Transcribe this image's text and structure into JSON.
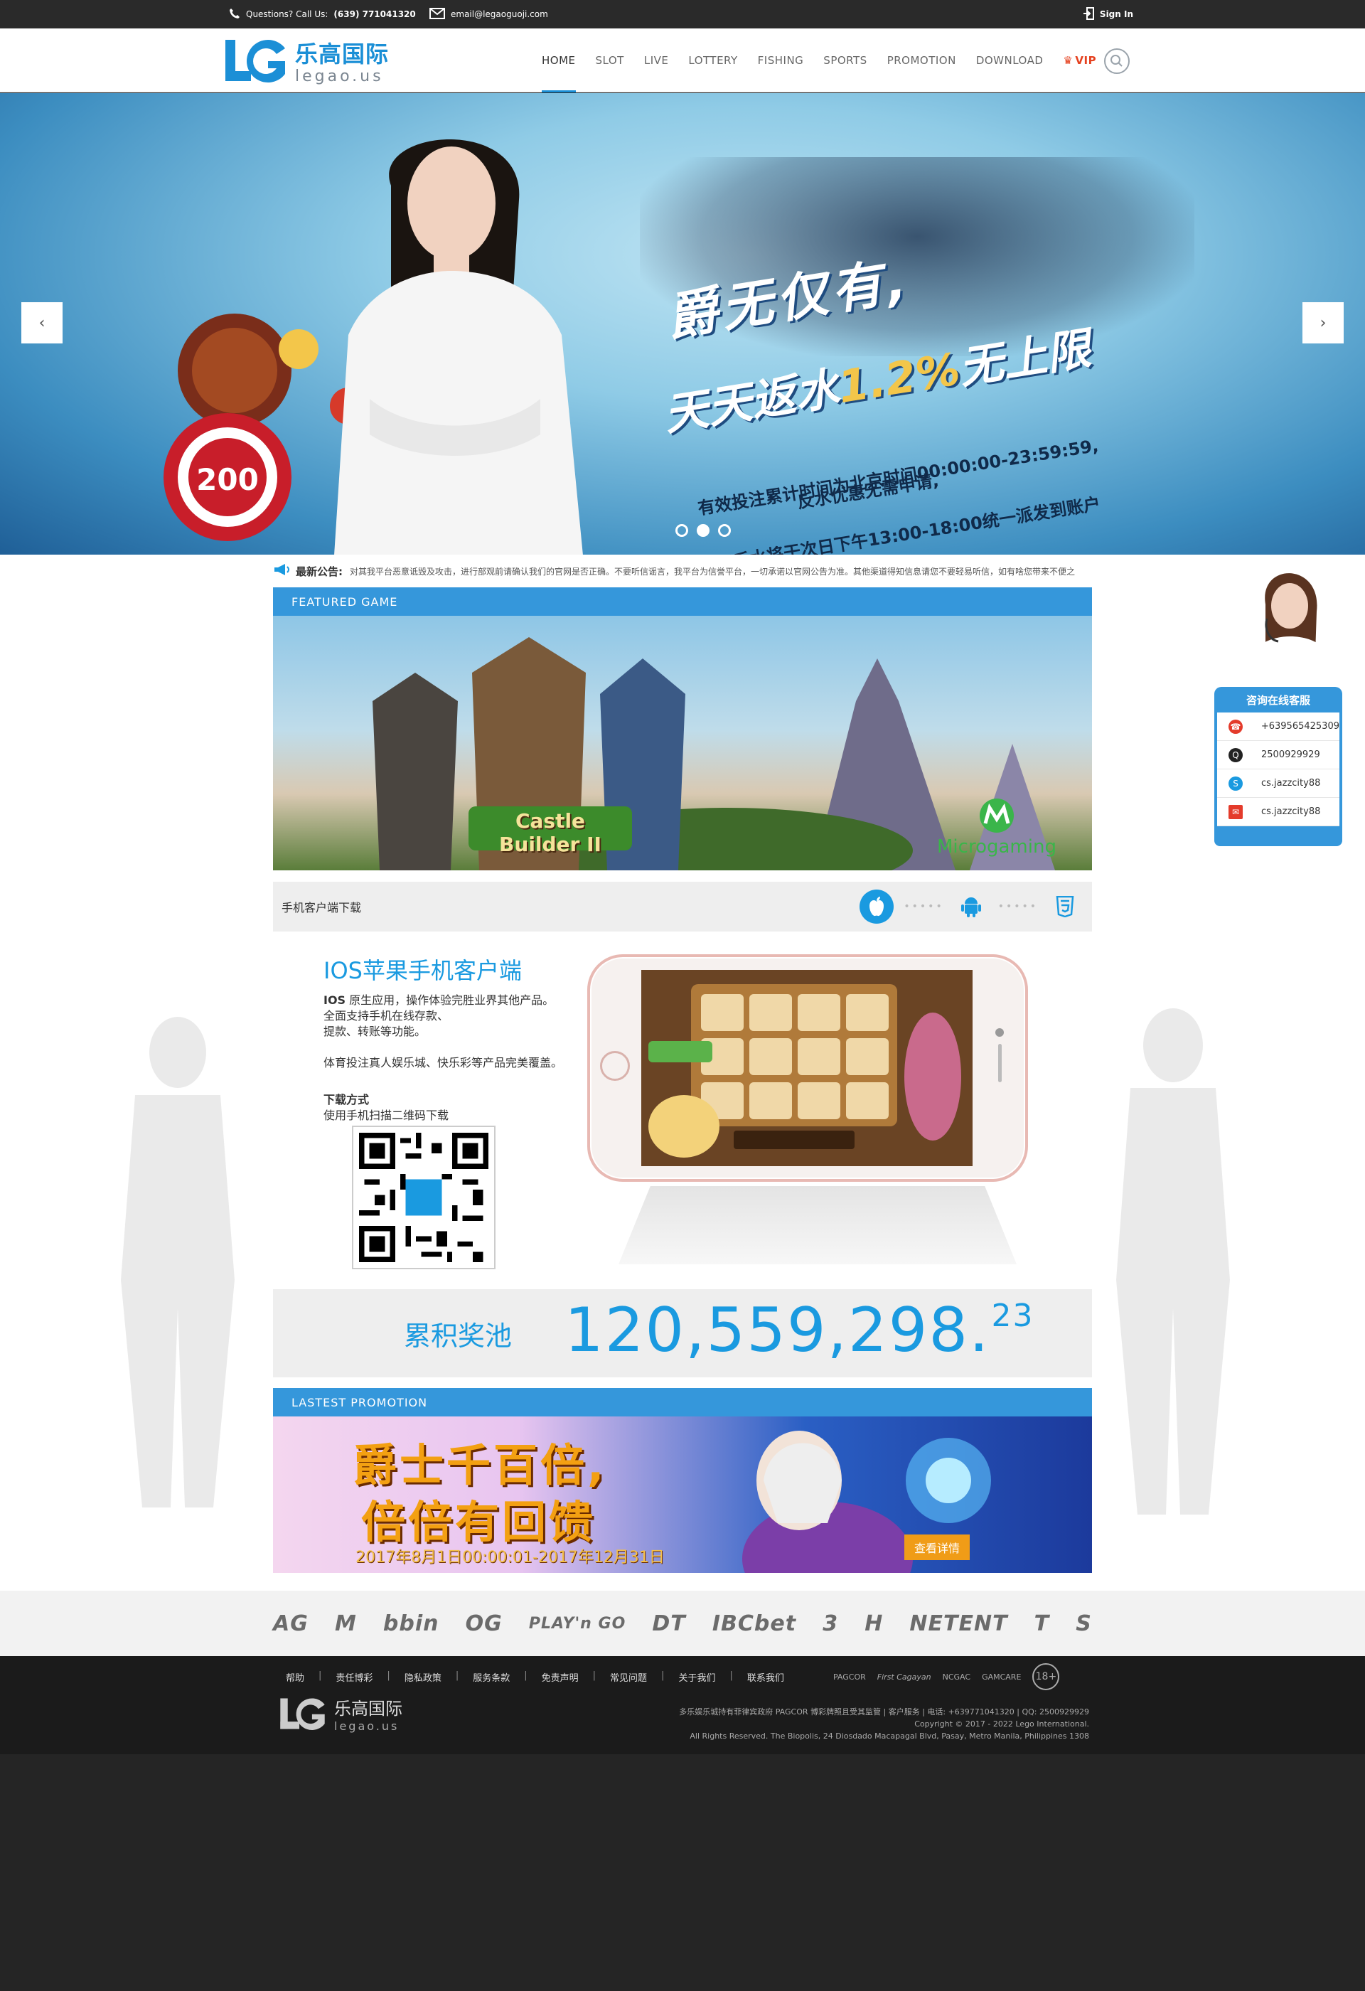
{
  "topbar": {
    "phone_label": "Questions? Call Us:",
    "phone_number": "(639) 771041320",
    "email": "email@legaoguoji.com",
    "signin": "Sign In"
  },
  "brand": {
    "name_cn": "乐高国际",
    "name_en": "legao.us"
  },
  "nav": [
    "HOME",
    "SLOT",
    "LIVE",
    "LOTTERY",
    "FISHING",
    "SPORTS",
    "PROMOTION",
    "DOWNLOAD",
    "VIP"
  ],
  "hero": {
    "headline": "爵无仅有,",
    "subline_a": "天天返水",
    "subline_b": "1.2%",
    "subline_c": "无上限",
    "desc_lines": [
      "有效投注累计时间为北京时间00:00:00-23:59:59,",
      "反水优惠无需申请,",
      "当天反水将于次日下午13:00-18:00统一派发到账户"
    ],
    "slides": 3,
    "active_slide": 2,
    "chip_value": "200"
  },
  "notice": {
    "label": "最新公告:",
    "message": "对其我平台恶意诋毁及攻击，进行部观前请确认我们的官网是否正确。不要听信谣言，我平台为信誉平台，一切承诺以官网公告为准。其他渠道得知信息请您不要轻易听信，如有啥您带来不便之"
  },
  "featured": {
    "title": "FEATURED GAME",
    "game_name": "Castle Builder II",
    "provider": "Microgaming"
  },
  "download": {
    "title": "手机客户端下载",
    "platforms": [
      "ios",
      "android",
      "html5"
    ],
    "active": "ios"
  },
  "ios": {
    "heading": "IOS苹果手机客户端",
    "lead": "IOS",
    "lines": [
      "原生应用，操作体验完胜业界其他产品。",
      "全面支持手机在线存款、",
      "提款、转账等功能。"
    ],
    "line2": "体育投注真人娱乐城、快乐彩等产品完美覆盖。",
    "dl_title": "下载方式",
    "dl_desc": "使用手机扫描二维码下载"
  },
  "jackpot": {
    "label": "累积奖池",
    "amount": "120,559,298.",
    "cents": "23"
  },
  "promo": {
    "title": "LASTEST PROMOTION",
    "line1": "爵士千百倍,",
    "line2": "倍倍有回馈",
    "date": "2017年8月1日00:00:01-2017年12月31日",
    "button": "查看详情"
  },
  "partners": [
    "AG",
    "M",
    "bbin",
    "OG",
    "PLAY'n GO",
    "DT",
    "IBCbet",
    "3",
    "H",
    "NETENT",
    "T",
    "S"
  ],
  "footer": {
    "links": [
      "帮助",
      "责任博彩",
      "隐私政策",
      "服务条款",
      "免责声明",
      "常见问题",
      "关于我们",
      "联系我们"
    ],
    "licenses": [
      "PAGCOR",
      "First Cagayan",
      "NCGAC",
      "GAMCARE",
      "18+"
    ],
    "copy_line1": "多乐娱乐城持有菲律宾政府 PAGCOR 博彩牌照且受其监管 | 客户服务 | 电话: +639771041320 | QQ: 2500929929",
    "copy_line2": "Copyright © 2017 - 2022 Lego International.",
    "copy_line3": "All Rights Reserved. The Biopolis, 24 Diosdado Macapagal Blvd, Pasay, Metro Manila, Philippines 1308"
  },
  "service": {
    "title": "咨询在线客服",
    "items": [
      {
        "icon": "telephone-icon",
        "value": "+639565425309",
        "color": "#e43b2b"
      },
      {
        "icon": "qq-icon",
        "value": "2500929929",
        "color": "#222222"
      },
      {
        "icon": "skype-icon",
        "value": "cs.jazzcity88",
        "color": "#1a9ae0"
      },
      {
        "icon": "mail-icon",
        "value": "cs.jazzcity88",
        "color": "#e43b2b"
      }
    ]
  },
  "colors": {
    "accent": "#1a9ae0",
    "section_bar": "#3597db",
    "vip": "#e5411f",
    "promo_button": "#f09c17"
  }
}
